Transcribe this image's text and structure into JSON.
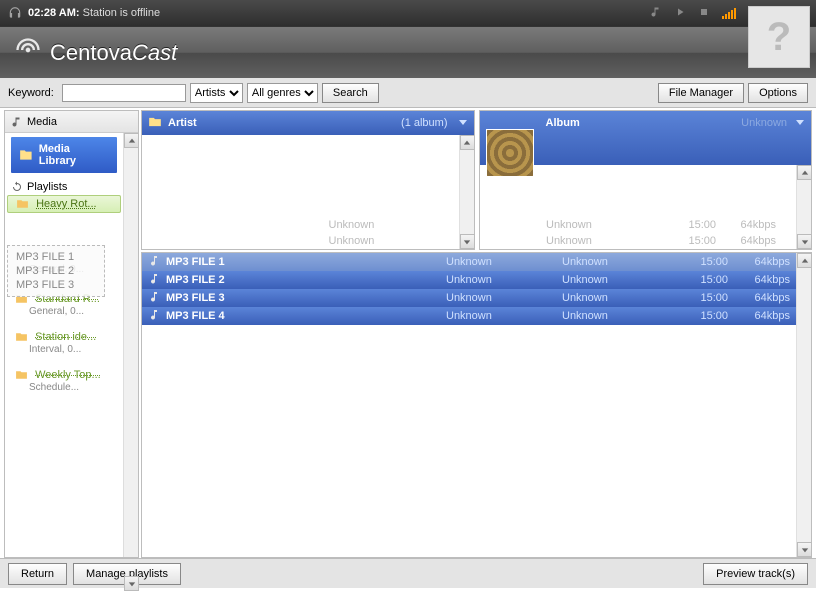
{
  "titlebar": {
    "time": "02:28 AM:",
    "status": "Station is offline"
  },
  "brand": {
    "name1": "Centova",
    "name2": "Cast"
  },
  "helpbox": "?",
  "toolbar": {
    "keyword_label": "Keyword:",
    "keyword_value": "",
    "category_select": "Artists",
    "genre_select": "All genres",
    "search_btn": "Search",
    "file_manager_btn": "File Manager",
    "options_btn": "Options"
  },
  "sidebar": {
    "media_header": "Media",
    "media_library": "Media Library",
    "playlists_header": "Playlists",
    "items": [
      {
        "name": "Heavy Rot...",
        "sub": "",
        "selected": true
      },
      {
        "name": "Standard R...",
        "sub": "General, 0..."
      },
      {
        "name": "Station ide...",
        "sub": "Interval, 0..."
      },
      {
        "name": "Weekly Top...",
        "sub": "Schedule..."
      }
    ]
  },
  "drag_ghost": {
    "rows": [
      {
        "name": "MP3 FILE 1",
        "sub": "General, 0..."
      },
      {
        "name": "MP3 FILE 2",
        "sub": ""
      },
      {
        "name": "MP3 FILE 3",
        "sub": "Station ide..."
      }
    ]
  },
  "artist_panel": {
    "title": "Artist",
    "count": "(1 album)"
  },
  "album_panel": {
    "title": "Album",
    "subtitle": "Unknown"
  },
  "ghost_tracks_artist": [
    {
      "c1": "",
      "c2": "Unknown",
      "c3": "",
      "c4": ""
    },
    {
      "c1": "",
      "c2": "Unknown",
      "c3": "",
      "c4": ""
    }
  ],
  "ghost_tracks_album": [
    {
      "c1": "",
      "c2": "Unknown",
      "c3": "15:00",
      "c4": "64kbps"
    },
    {
      "c1": "",
      "c2": "Unknown",
      "c3": "15:00",
      "c4": "64kbps"
    }
  ],
  "tracks": [
    {
      "name": "MP3 FILE 1",
      "artist": "Unknown",
      "album": "Unknown",
      "dur": "15:00",
      "br": "64kbps",
      "light": true
    },
    {
      "name": "MP3 FILE 2",
      "artist": "Unknown",
      "album": "Unknown",
      "dur": "15:00",
      "br": "64kbps",
      "light": false
    },
    {
      "name": "MP3 FILE 3",
      "artist": "Unknown",
      "album": "Unknown",
      "dur": "15:00",
      "br": "64kbps",
      "light": false
    },
    {
      "name": "MP3 FILE 4",
      "artist": "Unknown",
      "album": "Unknown",
      "dur": "15:00",
      "br": "64kbps",
      "light": false
    }
  ],
  "footer": {
    "return_btn": "Return",
    "manage_btn": "Manage playlists",
    "preview_btn": "Preview track(s)"
  }
}
